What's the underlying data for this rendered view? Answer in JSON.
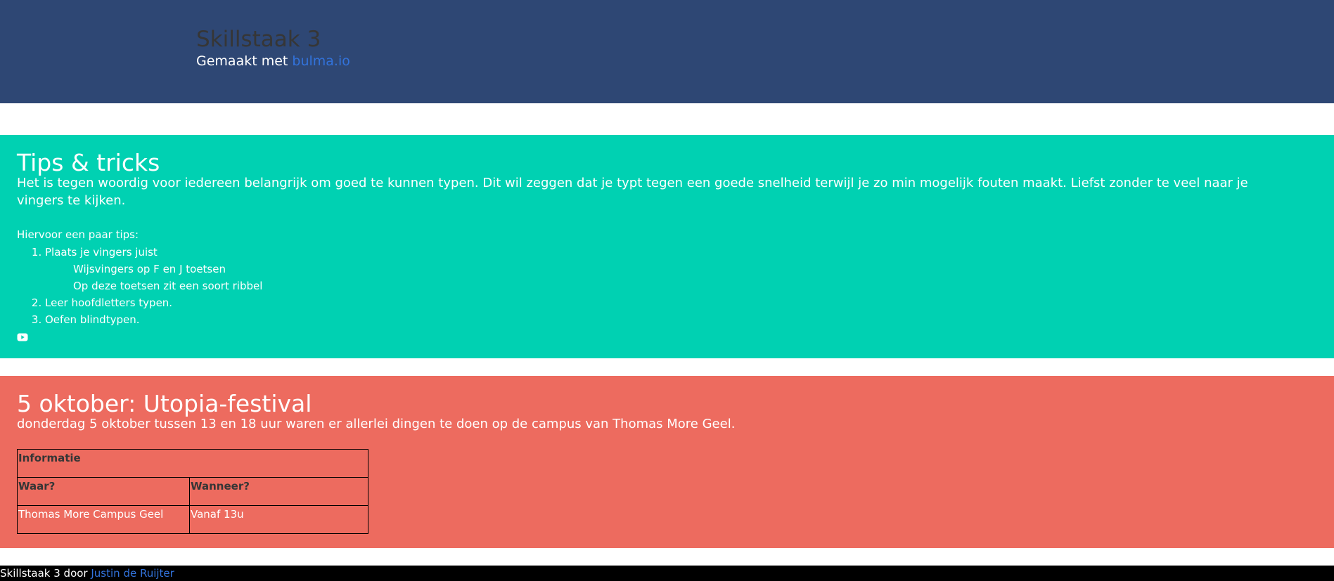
{
  "hero": {
    "title": "Skillstaak 3",
    "subtitle_prefix": "Gemaakt met ",
    "subtitle_link": "bulma.io"
  },
  "tips": {
    "title": "Tips & tricks",
    "lead": "Het is tegen woordig voor iedereen belangrijk om goed te kunnen typen. Dit wil zeggen dat je typt tegen een goede snelheid terwijl je zo min mogelijk fouten maakt. Liefst zonder te veel naar je vingers te kijken.",
    "intro": "Hiervoor een paar tips:",
    "items": [
      {
        "label": "Plaats je vingers juist",
        "sub": [
          "Wijsvingers op F en J toetsen",
          "Op deze toetsen zit een soort ribbel"
        ]
      },
      {
        "label": "Leer hoofdletters typen."
      },
      {
        "label": "Oefen blindtypen."
      }
    ],
    "icon": "youtube-icon"
  },
  "utopia": {
    "title": "5 oktober: Utopia-festival",
    "lead": "donderdag 5 oktober tussen 13 en 18 uur waren er allerlei dingen te doen op de campus van Thomas More Geel.",
    "table": {
      "caption": "Informatie",
      "headers": [
        "Waar?",
        "Wanneer?"
      ],
      "rows": [
        [
          "Thomas More Campus Geel",
          "Vanaf 13u"
        ]
      ]
    }
  },
  "footer": {
    "prefix": "Skillstaak 3 door ",
    "link": "Justin de Ruijter"
  },
  "colors": {
    "hero": "#2e4774",
    "tips": "#00d1b2",
    "utopia": "#ed6b5f",
    "link": "#3273dc"
  }
}
